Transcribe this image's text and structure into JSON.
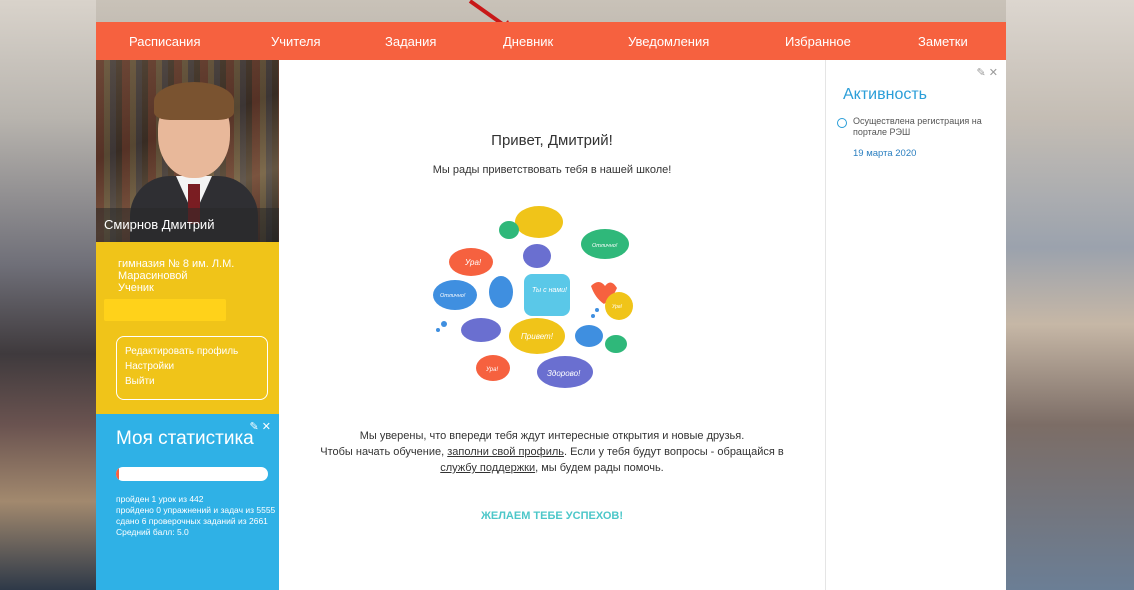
{
  "nav": {
    "items": [
      {
        "label": "Расписания"
      },
      {
        "label": "Учителя"
      },
      {
        "label": "Задания"
      },
      {
        "label": "Дневник"
      },
      {
        "label": "Уведомления"
      },
      {
        "label": "Избранное"
      },
      {
        "label": "Заметки"
      }
    ]
  },
  "profile": {
    "name": "Смирнов Дмитрий",
    "school_line1": "гимназия № 8 им. Л.М.",
    "school_line2": "Марасиновой",
    "role": "Ученик",
    "menu": [
      "Редактировать профиль",
      "Настройки",
      "Выйти"
    ]
  },
  "stats": {
    "title": "Моя статистика",
    "progress_fraction": 0.02,
    "lines": [
      "пройден 1 урок из 442",
      "пройдено 0 упражнений и задач из 5555",
      "сдано 6 проверочных заданий из 2661",
      "Средний балл: 5.0"
    ]
  },
  "main": {
    "greeting": "Привет, Дмитрий!",
    "subtitle": "Мы рады приветствовать тебя в нашей школе!",
    "body_line1": "Мы уверены, что впереди тебя ждут интересные открытия и новые друзья.",
    "body_line2_pre": "Чтобы начать обучение, ",
    "body_link1": "заполни свой профиль",
    "body_line2_post": ". Если у тебя будут вопросы - обращайся в",
    "body_link2": "службу поддержки",
    "body_line3_post": ", мы будем рады помочь.",
    "wish": "ЖЕЛАЕМ ТЕБЕ УСПЕХОВ!",
    "bubble_texts": [
      "Ура!",
      "Отлично!",
      "Отлично!",
      "Ты с нами!",
      "Ура!",
      "Привет!",
      "Ура!",
      "Здорово!"
    ]
  },
  "activity": {
    "title": "Активность",
    "items": [
      {
        "text": "Осуществлена регистрация на портале РЭШ",
        "date": "19 марта 2020"
      }
    ]
  },
  "colors": {
    "nav": "#f6613f",
    "yellow": "#f0c419",
    "stats": "#2fb1e6",
    "accent_blue": "#2b9ed8",
    "wish": "#4cc7c9"
  }
}
